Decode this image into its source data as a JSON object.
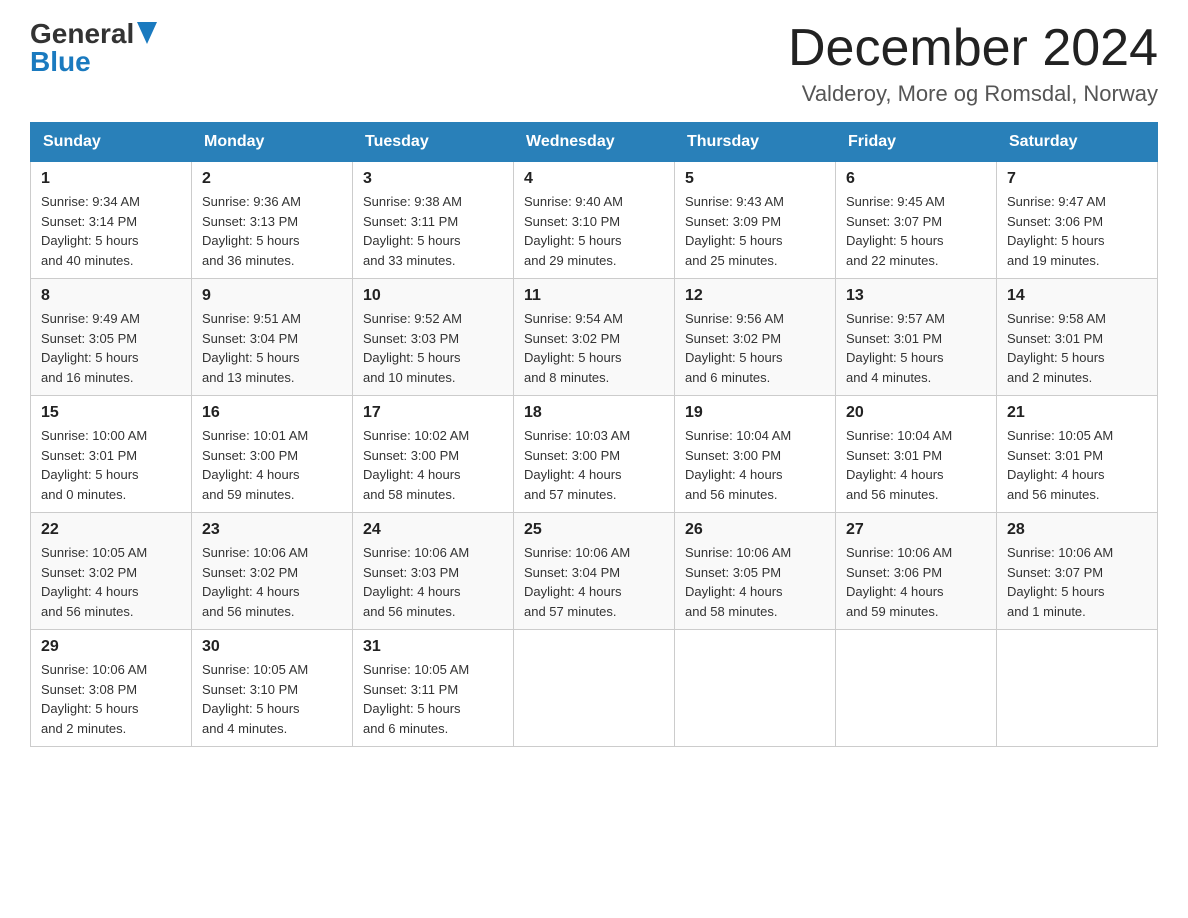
{
  "header": {
    "logo_general": "General",
    "logo_blue": "Blue",
    "month_title": "December 2024",
    "location": "Valderoy, More og Romsdal, Norway"
  },
  "weekdays": [
    "Sunday",
    "Monday",
    "Tuesday",
    "Wednesday",
    "Thursday",
    "Friday",
    "Saturday"
  ],
  "weeks": [
    [
      {
        "day": "1",
        "sunrise": "9:34 AM",
        "sunset": "3:14 PM",
        "daylight": "5 hours and 40 minutes."
      },
      {
        "day": "2",
        "sunrise": "9:36 AM",
        "sunset": "3:13 PM",
        "daylight": "5 hours and 36 minutes."
      },
      {
        "day": "3",
        "sunrise": "9:38 AM",
        "sunset": "3:11 PM",
        "daylight": "5 hours and 33 minutes."
      },
      {
        "day": "4",
        "sunrise": "9:40 AM",
        "sunset": "3:10 PM",
        "daylight": "5 hours and 29 minutes."
      },
      {
        "day": "5",
        "sunrise": "9:43 AM",
        "sunset": "3:09 PM",
        "daylight": "5 hours and 25 minutes."
      },
      {
        "day": "6",
        "sunrise": "9:45 AM",
        "sunset": "3:07 PM",
        "daylight": "5 hours and 22 minutes."
      },
      {
        "day": "7",
        "sunrise": "9:47 AM",
        "sunset": "3:06 PM",
        "daylight": "5 hours and 19 minutes."
      }
    ],
    [
      {
        "day": "8",
        "sunrise": "9:49 AM",
        "sunset": "3:05 PM",
        "daylight": "5 hours and 16 minutes."
      },
      {
        "day": "9",
        "sunrise": "9:51 AM",
        "sunset": "3:04 PM",
        "daylight": "5 hours and 13 minutes."
      },
      {
        "day": "10",
        "sunrise": "9:52 AM",
        "sunset": "3:03 PM",
        "daylight": "5 hours and 10 minutes."
      },
      {
        "day": "11",
        "sunrise": "9:54 AM",
        "sunset": "3:02 PM",
        "daylight": "5 hours and 8 minutes."
      },
      {
        "day": "12",
        "sunrise": "9:56 AM",
        "sunset": "3:02 PM",
        "daylight": "5 hours and 6 minutes."
      },
      {
        "day": "13",
        "sunrise": "9:57 AM",
        "sunset": "3:01 PM",
        "daylight": "5 hours and 4 minutes."
      },
      {
        "day": "14",
        "sunrise": "9:58 AM",
        "sunset": "3:01 PM",
        "daylight": "5 hours and 2 minutes."
      }
    ],
    [
      {
        "day": "15",
        "sunrise": "10:00 AM",
        "sunset": "3:01 PM",
        "daylight": "5 hours and 0 minutes."
      },
      {
        "day": "16",
        "sunrise": "10:01 AM",
        "sunset": "3:00 PM",
        "daylight": "4 hours and 59 minutes."
      },
      {
        "day": "17",
        "sunrise": "10:02 AM",
        "sunset": "3:00 PM",
        "daylight": "4 hours and 58 minutes."
      },
      {
        "day": "18",
        "sunrise": "10:03 AM",
        "sunset": "3:00 PM",
        "daylight": "4 hours and 57 minutes."
      },
      {
        "day": "19",
        "sunrise": "10:04 AM",
        "sunset": "3:00 PM",
        "daylight": "4 hours and 56 minutes."
      },
      {
        "day": "20",
        "sunrise": "10:04 AM",
        "sunset": "3:01 PM",
        "daylight": "4 hours and 56 minutes."
      },
      {
        "day": "21",
        "sunrise": "10:05 AM",
        "sunset": "3:01 PM",
        "daylight": "4 hours and 56 minutes."
      }
    ],
    [
      {
        "day": "22",
        "sunrise": "10:05 AM",
        "sunset": "3:02 PM",
        "daylight": "4 hours and 56 minutes."
      },
      {
        "day": "23",
        "sunrise": "10:06 AM",
        "sunset": "3:02 PM",
        "daylight": "4 hours and 56 minutes."
      },
      {
        "day": "24",
        "sunrise": "10:06 AM",
        "sunset": "3:03 PM",
        "daylight": "4 hours and 56 minutes."
      },
      {
        "day": "25",
        "sunrise": "10:06 AM",
        "sunset": "3:04 PM",
        "daylight": "4 hours and 57 minutes."
      },
      {
        "day": "26",
        "sunrise": "10:06 AM",
        "sunset": "3:05 PM",
        "daylight": "4 hours and 58 minutes."
      },
      {
        "day": "27",
        "sunrise": "10:06 AM",
        "sunset": "3:06 PM",
        "daylight": "4 hours and 59 minutes."
      },
      {
        "day": "28",
        "sunrise": "10:06 AM",
        "sunset": "3:07 PM",
        "daylight": "5 hours and 1 minute."
      }
    ],
    [
      {
        "day": "29",
        "sunrise": "10:06 AM",
        "sunset": "3:08 PM",
        "daylight": "5 hours and 2 minutes."
      },
      {
        "day": "30",
        "sunrise": "10:05 AM",
        "sunset": "3:10 PM",
        "daylight": "5 hours and 4 minutes."
      },
      {
        "day": "31",
        "sunrise": "10:05 AM",
        "sunset": "3:11 PM",
        "daylight": "5 hours and 6 minutes."
      },
      null,
      null,
      null,
      null
    ]
  ],
  "labels": {
    "sunrise": "Sunrise:",
    "sunset": "Sunset:",
    "daylight": "Daylight:"
  }
}
